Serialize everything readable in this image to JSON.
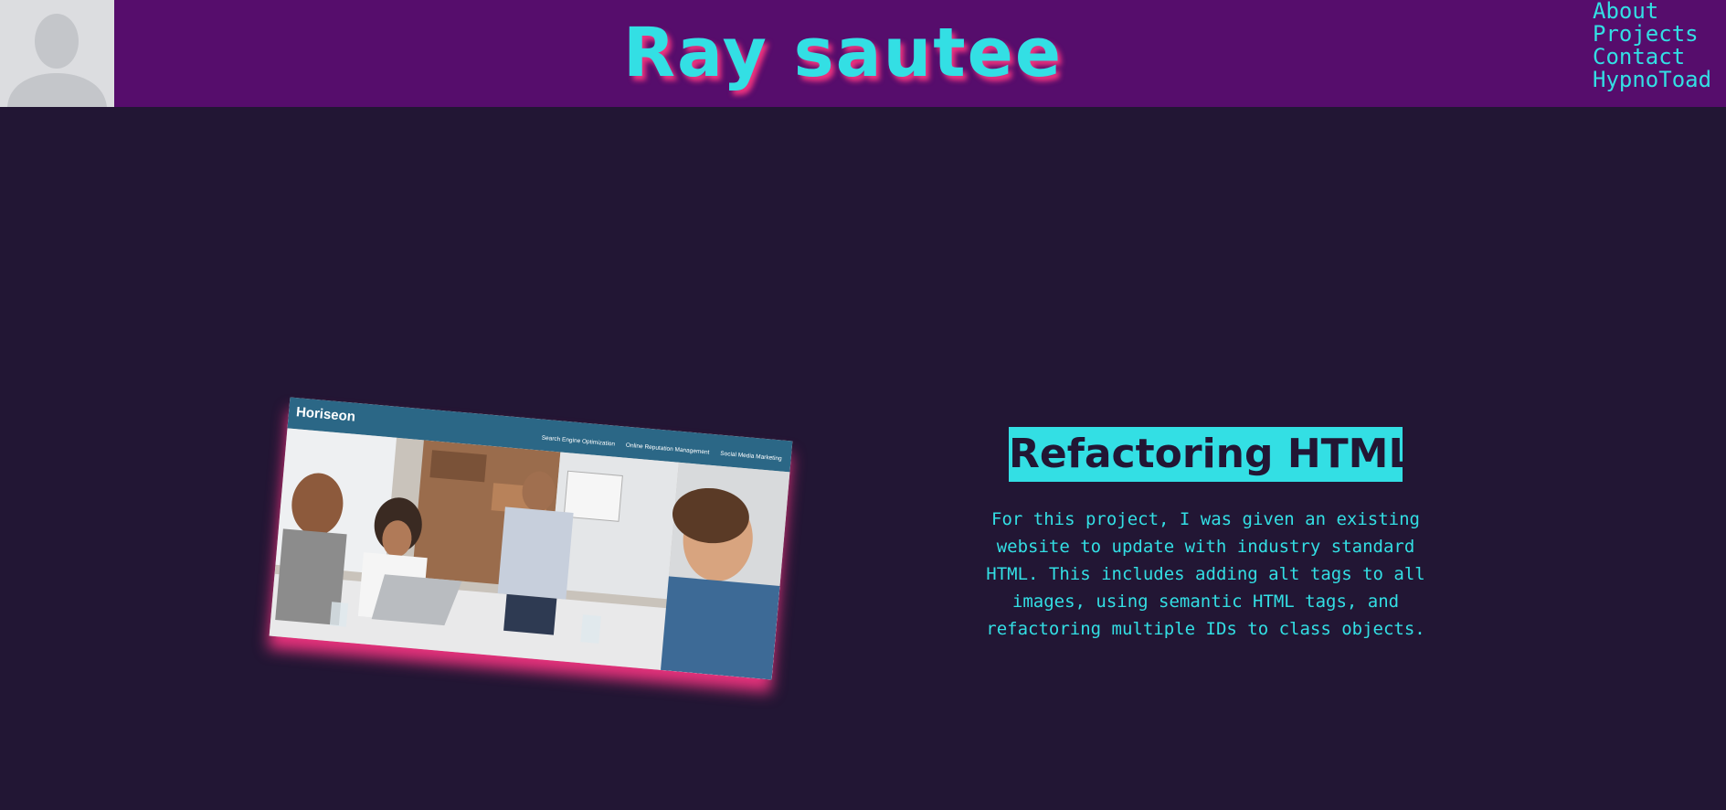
{
  "header": {
    "title": "Ray sautee",
    "avatar_alt": "profile-placeholder",
    "nav": [
      {
        "label": "About"
      },
      {
        "label": "Projects"
      },
      {
        "label": "Contact"
      },
      {
        "label": "HypnoToad"
      }
    ]
  },
  "project": {
    "title": "Refactoring HTML",
    "description": "For this project, I was given an existing website to update with industry standard HTML. This includes adding alt tags to all images, using semantic HTML tags, and refactoring multiple IDs to class objects.",
    "screenshot": {
      "brand": "Horiseon",
      "links": [
        "Search Engine Optimization",
        "Online Reputation Management",
        "Social Media Marketing"
      ]
    }
  },
  "colors": {
    "page_bg": "#221634",
    "header_bg": "#560d6c",
    "accent": "#33dfe4",
    "glow": "#f0347f"
  }
}
